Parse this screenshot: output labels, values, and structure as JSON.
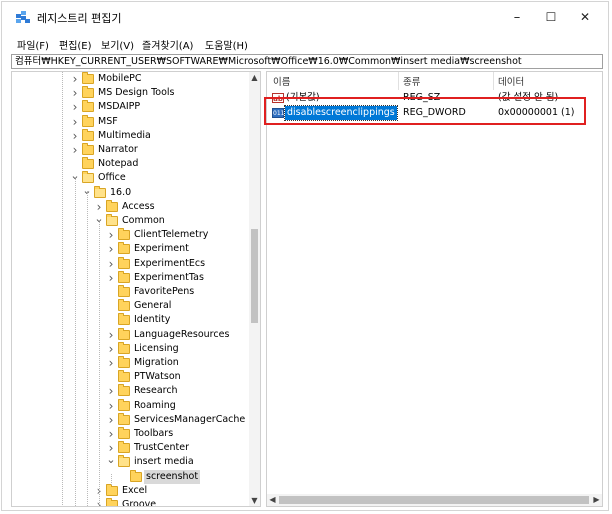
{
  "window": {
    "title": "레지스트리 편집기",
    "minimize": "–",
    "maximize": "☐",
    "close": "✕"
  },
  "menu": [
    "파일(F)",
    "편집(E)",
    "보기(V)",
    "즐겨찾기(A)",
    "도움말(H)"
  ],
  "address": "컴퓨터₩HKEY_CURRENT_USER₩SOFTWARE₩Microsoft₩Office₩16.0₩Common₩insert media₩screenshot",
  "tree": [
    {
      "label": "MobilePC",
      "level": 0,
      "expander": "collapsed"
    },
    {
      "label": "MS Design Tools",
      "level": 0,
      "expander": "collapsed"
    },
    {
      "label": "MSDAIPP",
      "level": 0,
      "expander": "collapsed"
    },
    {
      "label": "MSF",
      "level": 0,
      "expander": "collapsed"
    },
    {
      "label": "Multimedia",
      "level": 0,
      "expander": "collapsed"
    },
    {
      "label": "Narrator",
      "level": 0,
      "expander": "collapsed"
    },
    {
      "label": "Notepad",
      "level": 0,
      "expander": "none"
    },
    {
      "label": "Office",
      "level": 0,
      "expander": "expanded"
    },
    {
      "label": "16.0",
      "level": 1,
      "expander": "expanded"
    },
    {
      "label": "Access",
      "level": 2,
      "expander": "collapsed"
    },
    {
      "label": "Common",
      "level": 2,
      "expander": "expanded"
    },
    {
      "label": "ClientTelemetry",
      "level": 3,
      "expander": "collapsed"
    },
    {
      "label": "Experiment",
      "level": 3,
      "expander": "collapsed"
    },
    {
      "label": "ExperimentEcs",
      "level": 3,
      "expander": "collapsed"
    },
    {
      "label": "ExperimentTas",
      "level": 3,
      "expander": "collapsed"
    },
    {
      "label": "FavoritePens",
      "level": 3,
      "expander": "none"
    },
    {
      "label": "General",
      "level": 3,
      "expander": "none"
    },
    {
      "label": "Identity",
      "level": 3,
      "expander": "none"
    },
    {
      "label": "LanguageResources",
      "level": 3,
      "expander": "collapsed"
    },
    {
      "label": "Licensing",
      "level": 3,
      "expander": "collapsed"
    },
    {
      "label": "Migration",
      "level": 3,
      "expander": "collapsed"
    },
    {
      "label": "PTWatson",
      "level": 3,
      "expander": "none"
    },
    {
      "label": "Research",
      "level": 3,
      "expander": "collapsed"
    },
    {
      "label": "Roaming",
      "level": 3,
      "expander": "collapsed"
    },
    {
      "label": "ServicesManagerCache",
      "level": 3,
      "expander": "collapsed"
    },
    {
      "label": "Toolbars",
      "level": 3,
      "expander": "collapsed"
    },
    {
      "label": "TrustCenter",
      "level": 3,
      "expander": "collapsed"
    },
    {
      "label": "insert media",
      "level": 3,
      "expander": "expanded"
    },
    {
      "label": "screenshot",
      "level": 4,
      "expander": "none",
      "selected": true
    },
    {
      "label": "Excel",
      "level": 2,
      "expander": "collapsed"
    },
    {
      "label": "Groove",
      "level": 2,
      "expander": "collapsed"
    }
  ],
  "columns": [
    "이름",
    "종류",
    "데이터"
  ],
  "values": [
    {
      "name": "(기본값)",
      "type": "REG_SZ",
      "data": "(값 설정 안 됨)",
      "icon": "string-value-icon"
    },
    {
      "name": "disablescreenclippings",
      "type": "REG_DWORD",
      "data": "0x00000001 (1)",
      "icon": "dword-value-icon",
      "selected": true
    }
  ],
  "colors": {
    "selection": "#0078d7",
    "highlight_box": "#e02020",
    "folder": "#ffd35c"
  }
}
